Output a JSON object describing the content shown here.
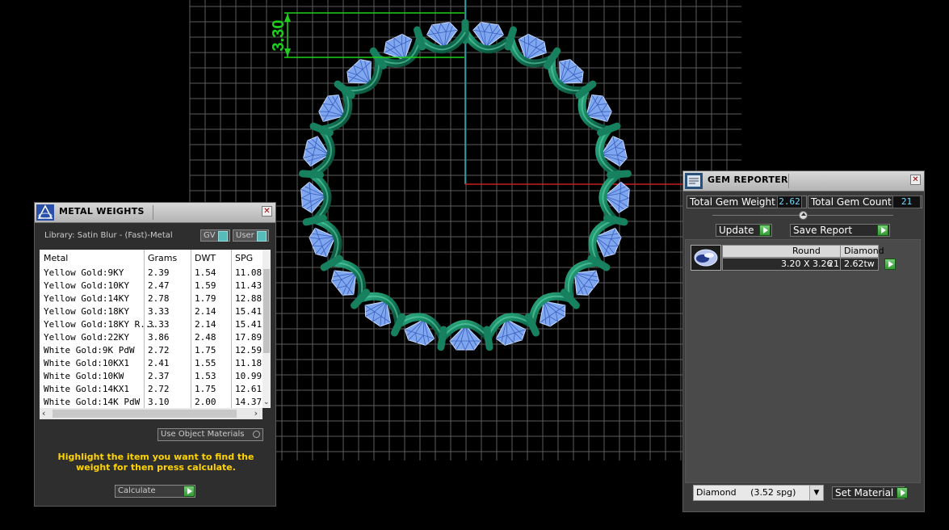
{
  "ring_dimension": {
    "label": "3.30"
  },
  "metal_weights": {
    "title": "METAL WEIGHTS",
    "library": "Library: Satin Blur - (Fast)-Metal",
    "gv_label": "GV",
    "user_label": "User",
    "columns": [
      "Metal",
      "Grams",
      "DWT",
      "SPG"
    ],
    "rows": [
      {
        "metal": "Yellow Gold:9KY",
        "grams": "2.39",
        "dwt": "1.54",
        "spg": "11.08"
      },
      {
        "metal": "Yellow Gold:10KY",
        "grams": "2.47",
        "dwt": "1.59",
        "spg": "11.43"
      },
      {
        "metal": "Yellow Gold:14KY",
        "grams": "2.78",
        "dwt": "1.79",
        "spg": "12.88"
      },
      {
        "metal": "Yellow Gold:18KY",
        "grams": "3.33",
        "dwt": "2.14",
        "spg": "15.41"
      },
      {
        "metal": "Yellow Gold:18KY R...",
        "grams": "3.33",
        "dwt": "2.14",
        "spg": "15.41"
      },
      {
        "metal": "Yellow Gold:22KY",
        "grams": "3.86",
        "dwt": "2.48",
        "spg": "17.89"
      },
      {
        "metal": "White Gold:9K PdW",
        "grams": "2.72",
        "dwt": "1.75",
        "spg": "12.59"
      },
      {
        "metal": "White Gold:10KX1",
        "grams": "2.41",
        "dwt": "1.55",
        "spg": "11.18"
      },
      {
        "metal": "White Gold:10KW",
        "grams": "2.37",
        "dwt": "1.53",
        "spg": "10.99"
      },
      {
        "metal": "White Gold:14KX1",
        "grams": "2.72",
        "dwt": "1.75",
        "spg": "12.61"
      },
      {
        "metal": "White Gold:14K PdW",
        "grams": "3.10",
        "dwt": "2.00",
        "spg": "14.37"
      }
    ],
    "use_object_materials": "Use Object Materials",
    "instruction": "Highlight the item you want to find the weight for then press calculate.",
    "calculate_label": "Calculate"
  },
  "gem_reporter": {
    "title": "GEM REPORTER",
    "total_gem_weight_label": "Total Gem Weight",
    "total_gem_weight": "2.62",
    "total_gem_count_label": "Total Gem Count",
    "total_gem_count": "21",
    "update_label": "Update",
    "save_report_label": "Save Report",
    "gem": {
      "shape": "Round",
      "material": "Diamond",
      "size": "3.20 X 3.26",
      "count": "21",
      "weight": "2.62tw"
    },
    "material_select": "Diamond     (3.52 spg)",
    "set_material_label": "Set Material"
  }
}
